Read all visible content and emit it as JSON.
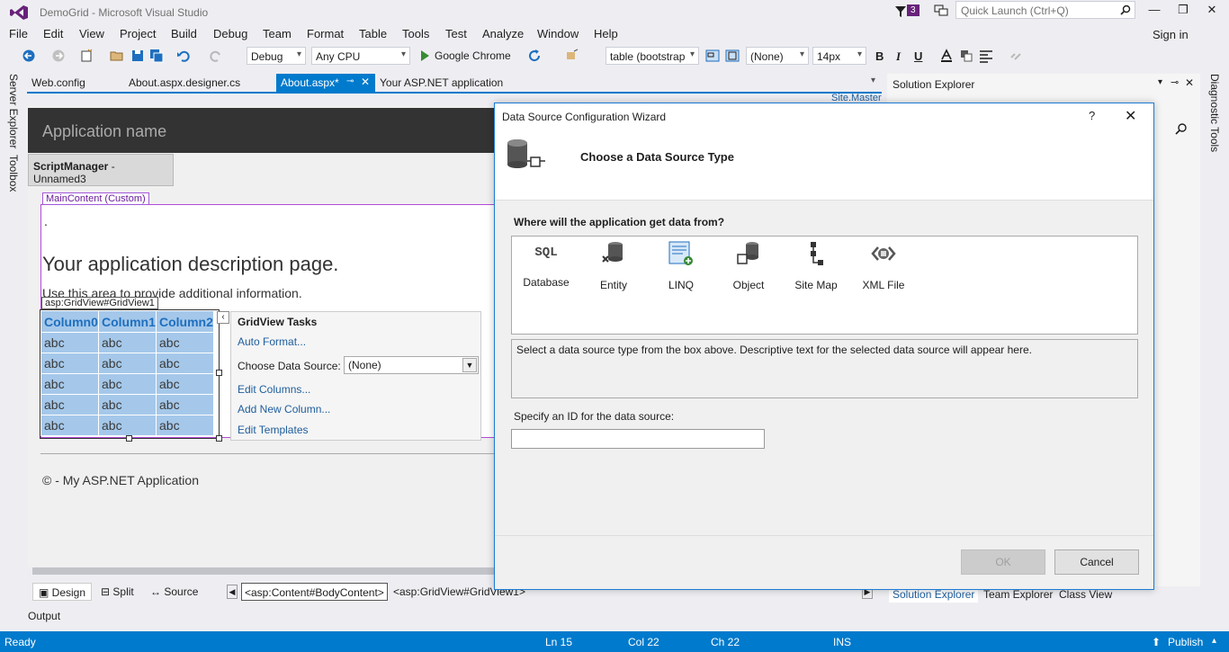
{
  "window": {
    "title": "DemoGrid - Microsoft Visual Studio",
    "notifications": "3",
    "quick_launch_placeholder": "Quick Launch (Ctrl+Q)",
    "sign_in": "Sign in"
  },
  "menu": [
    "File",
    "Edit",
    "View",
    "Project",
    "Build",
    "Debug",
    "Team",
    "Format",
    "Table",
    "Tools",
    "Test",
    "Analyze",
    "Window",
    "Help"
  ],
  "toolbar": {
    "config": "Debug",
    "platform": "Any CPU",
    "run_target": "Google Chrome",
    "css_class": "table (bootstrap",
    "style": "(None)",
    "font_size": "14px",
    "bold": "B",
    "italic": "I",
    "underline": "U"
  },
  "side": {
    "server_explorer": "Server Explorer",
    "toolbox": "Toolbox",
    "diagnostic_tools": "Diagnostic Tools"
  },
  "doc_tabs": {
    "web_config": "Web.config",
    "designer": "About.aspx.designer.cs",
    "about": "About.aspx*",
    "app": "Your ASP.NET application",
    "site_master": "Site.Master"
  },
  "design": {
    "app_name": "Application name",
    "script_manager": "ScriptManager",
    "script_manager_name": " - Unnamed3",
    "main_content_label": "MainContent (Custom)",
    "bullet": ".",
    "heading": "Your application description page.",
    "description": "Use this area to provide additional information.",
    "gridview_label": "asp:GridView#GridView1",
    "grid": {
      "columns": [
        "Column0",
        "Column1",
        "Column2"
      ],
      "rows": [
        [
          "abc",
          "abc",
          "abc"
        ],
        [
          "abc",
          "abc",
          "abc"
        ],
        [
          "abc",
          "abc",
          "abc"
        ],
        [
          "abc",
          "abc",
          "abc"
        ],
        [
          "abc",
          "abc",
          "abc"
        ]
      ]
    },
    "tasks": {
      "title": "GridView Tasks",
      "auto_format": "Auto Format...",
      "choose_source_label": "Choose Data Source:",
      "choose_source_value": "(None)",
      "edit_columns": "Edit Columns...",
      "add_new_column": "Add New Column...",
      "edit_templates": "Edit Templates"
    },
    "footer": "© - My ASP.NET Application"
  },
  "design_bar": {
    "design": "Design",
    "split": "Split",
    "source": "Source",
    "crumb1": "<asp:Content#BodyContent>",
    "crumb2": "<asp:GridView#GridView1>"
  },
  "output": "Output",
  "solution_explorer": {
    "title": "Solution Explorer",
    "tabs": [
      "Solution Explorer",
      "Team Explorer",
      "Class View"
    ]
  },
  "status": {
    "state": "Ready",
    "ln": "Ln 15",
    "col": "Col 22",
    "ch": "Ch 22",
    "mode": "INS",
    "publish": "Publish"
  },
  "dialog": {
    "title": "Data Source Configuration Wizard",
    "help": "?",
    "heading": "Choose a Data Source Type",
    "question": "Where will the application get data from?",
    "types": [
      {
        "label": "Database",
        "icon": "database-sql-icon"
      },
      {
        "label": "Entity",
        "icon": "entity-icon"
      },
      {
        "label": "LINQ",
        "icon": "linq-icon"
      },
      {
        "label": "Object",
        "icon": "object-icon"
      },
      {
        "label": "Site Map",
        "icon": "site-map-icon"
      },
      {
        "label": "XML File",
        "icon": "xml-file-icon"
      }
    ],
    "sql_text": "SQL",
    "description": "Select a data source type from the box above. Descriptive text for the selected data source will appear here.",
    "id_label": "Specify an ID for the data source:",
    "id_value": "",
    "ok": "OK",
    "cancel": "Cancel"
  }
}
